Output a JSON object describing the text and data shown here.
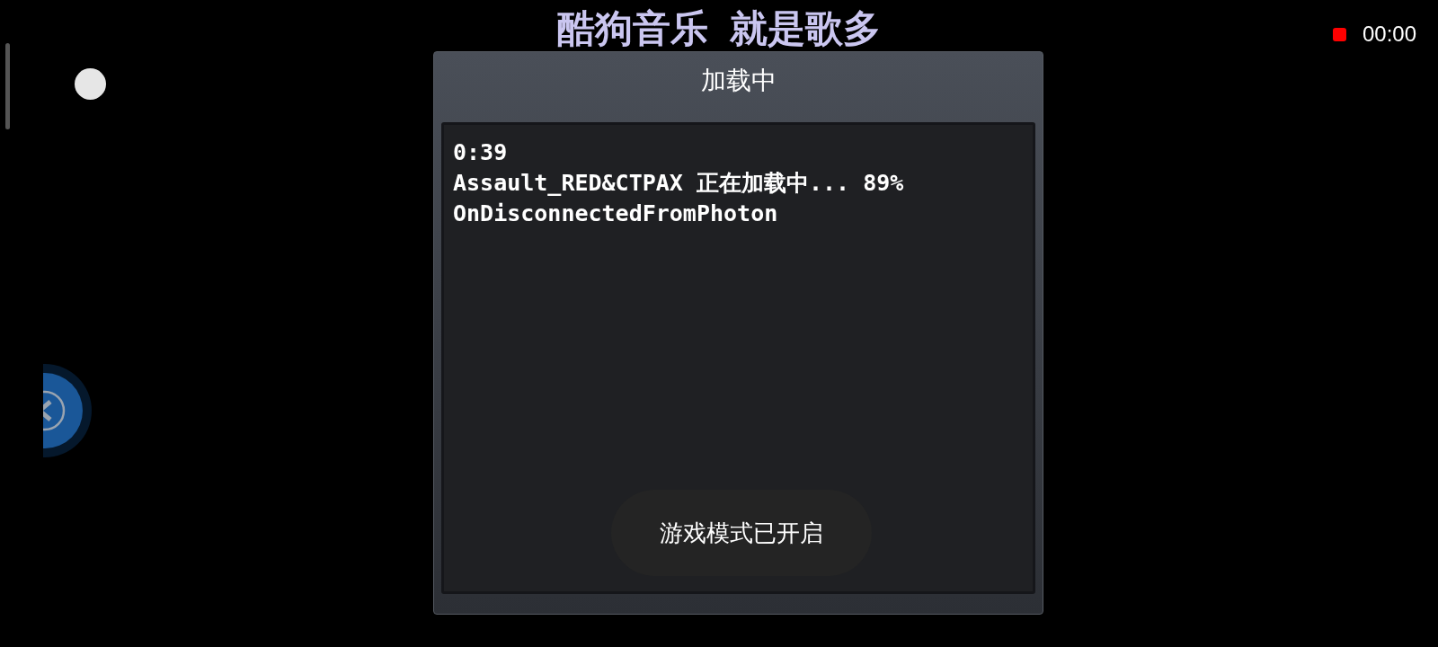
{
  "banner": {
    "text": "酷狗音乐  就是歌多"
  },
  "recording": {
    "time": "00:00"
  },
  "dialog": {
    "title": "加载中",
    "log_lines": [
      "0:39",
      "Assault_RED&CTPAX 正在加载中... 89%",
      "OnDisconnectedFromPhoton"
    ]
  },
  "toast": {
    "text": "游戏模式已开启"
  }
}
